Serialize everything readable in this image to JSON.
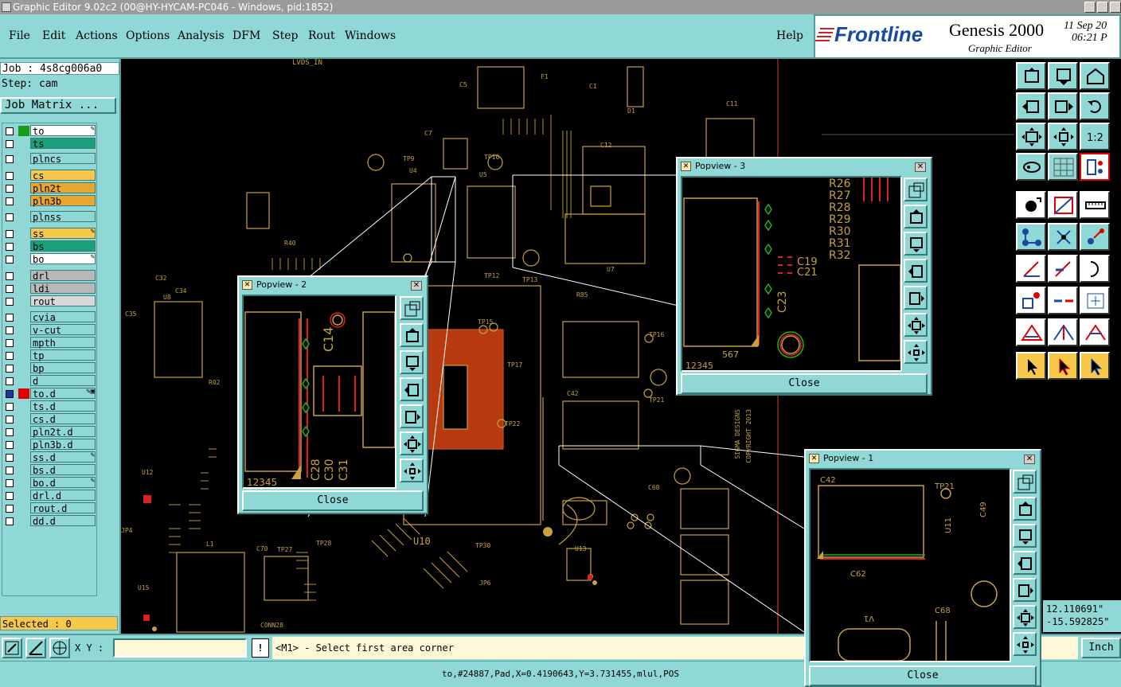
{
  "window": {
    "title": "Graphic Editor 9.02c2 (00@HY-HYCAM-PC046 - Windows, pid:1852)"
  },
  "menu": {
    "items": [
      "File",
      "Edit",
      "Actions",
      "Options",
      "Analysis",
      "DFM",
      "Step",
      "Rout",
      "Windows"
    ],
    "help": "Help"
  },
  "brand": {
    "logo": "Frontline",
    "product": "Genesis 2000",
    "subtitle": "Graphic Editor",
    "date": "11 Sep 20",
    "time": "06:21 P"
  },
  "job": {
    "job": "Job : 4s8cg006a0",
    "step": "Step: cam",
    "matrix_button": "Job Matrix ..."
  },
  "layers": [
    {
      "name": "to",
      "color": "#1a9a1a",
      "bg": "#ffffff",
      "icon": "✎"
    },
    {
      "name": "ts",
      "color": "",
      "bg": "#1aa07a",
      "icon": ""
    },
    {
      "name": "plncs",
      "color": "",
      "bg": "#8fd8d6",
      "icon": ""
    },
    {
      "name": "cs",
      "color": "",
      "bg": "#f7c84a",
      "icon": ""
    },
    {
      "name": "pln2t",
      "color": "",
      "bg": "#e8a830",
      "icon": ""
    },
    {
      "name": "pln3b",
      "color": "",
      "bg": "#e8a830",
      "icon": ""
    },
    {
      "name": "plnss",
      "color": "",
      "bg": "#8fd8d6",
      "icon": ""
    },
    {
      "name": "ss",
      "color": "",
      "bg": "#f7c84a",
      "icon": "✎"
    },
    {
      "name": "bs",
      "color": "",
      "bg": "#1aa07a",
      "icon": ""
    },
    {
      "name": "bo",
      "color": "",
      "bg": "#ffffff",
      "icon": "✎"
    },
    {
      "name": "drl",
      "color": "",
      "bg": "#b8b8b8",
      "icon": ""
    },
    {
      "name": "ldi",
      "color": "",
      "bg": "#b8b8b8",
      "icon": ""
    },
    {
      "name": "rout",
      "color": "",
      "bg": "#d8d8d8",
      "icon": ""
    },
    {
      "name": "cvia",
      "color": "",
      "bg": "#8fd8d6",
      "icon": ""
    },
    {
      "name": "v-cut",
      "color": "",
      "bg": "#8fd8d6",
      "icon": ""
    },
    {
      "name": "mpth",
      "color": "",
      "bg": "#8fd8d6",
      "icon": ""
    },
    {
      "name": "tp",
      "color": "",
      "bg": "#8fd8d6",
      "icon": ""
    },
    {
      "name": "bp",
      "color": "",
      "bg": "#8fd8d6",
      "icon": ""
    },
    {
      "name": "d",
      "color": "",
      "bg": "#8fd8d6",
      "icon": ""
    },
    {
      "name": "to.d",
      "color": "#e00000",
      "bg": "#8fd8d6",
      "icon": "✎▣"
    },
    {
      "name": "ts.d",
      "color": "",
      "bg": "#8fd8d6",
      "icon": ""
    },
    {
      "name": "cs.d",
      "color": "",
      "bg": "#8fd8d6",
      "icon": ""
    },
    {
      "name": "pln2t.d",
      "color": "",
      "bg": "#8fd8d6",
      "icon": ""
    },
    {
      "name": "pln3b.d",
      "color": "",
      "bg": "#8fd8d6",
      "icon": ""
    },
    {
      "name": "ss.d",
      "color": "",
      "bg": "#8fd8d6",
      "icon": "✎"
    },
    {
      "name": "bs.d",
      "color": "",
      "bg": "#8fd8d6",
      "icon": ""
    },
    {
      "name": "bo.d",
      "color": "",
      "bg": "#8fd8d6",
      "icon": "✎"
    },
    {
      "name": "drl.d",
      "color": "",
      "bg": "#8fd8d6",
      "icon": ""
    },
    {
      "name": "rout.d",
      "color": "",
      "bg": "#8fd8d6",
      "icon": ""
    },
    {
      "name": "dd.d",
      "color": "",
      "bg": "#8fd8d6",
      "icon": ""
    }
  ],
  "selected": "Selected : 0",
  "coords": {
    "x": "12.110691\"",
    "y": "-15.592825\""
  },
  "command": {
    "xy_label": "X Y :",
    "xy_value": "",
    "prompt": "<M1> - Select first area corner",
    "units": "Inch"
  },
  "status": "to,#24887,Pad,X=0.4190643,Y=3.731455,mlul,POS",
  "popviews": [
    {
      "title": "Popview - 2",
      "close": "Close"
    },
    {
      "title": "Popview - 3",
      "close": "Close"
    },
    {
      "title": "Popview - 1",
      "close": "Close"
    }
  ],
  "board_labels": {
    "u10": "U10",
    "u4": "U4",
    "u5": "U5",
    "u7": "U7",
    "u8": "U8",
    "u11": "U11",
    "u12": "U12",
    "u13": "U13",
    "u15": "U15",
    "l1": "L1",
    "f1": "F1",
    "c5": "C5",
    "c1": "C1",
    "c12": "C12",
    "c11": "C11",
    "c7": "C7",
    "d1": "D1",
    "tp9": "TP9",
    "tp10": "TP10",
    "tp12": "TP12",
    "tp13": "TP13",
    "tp14": "TP14",
    "tp15": "TP15",
    "tp16": "TP16",
    "tp17": "TP17",
    "tp21": "TP21",
    "tp22": "TP22",
    "tp27": "TP27",
    "tp28": "TP28",
    "tp30": "TP30",
    "r85": "R85",
    "r02": "R02",
    "r40": "R40",
    "c32": "C32",
    "c34": "C34",
    "c35": "C35",
    "c42": "C42",
    "c68": "C68",
    "c70": "C70",
    "jp4": "JP4",
    "jp6": "JP6",
    "conn28": "CONN28",
    "lvds": "LVDS_IN",
    "copyright": "COPYRIGHT 2013",
    "sigma": "SIGMA DESIGNS"
  }
}
